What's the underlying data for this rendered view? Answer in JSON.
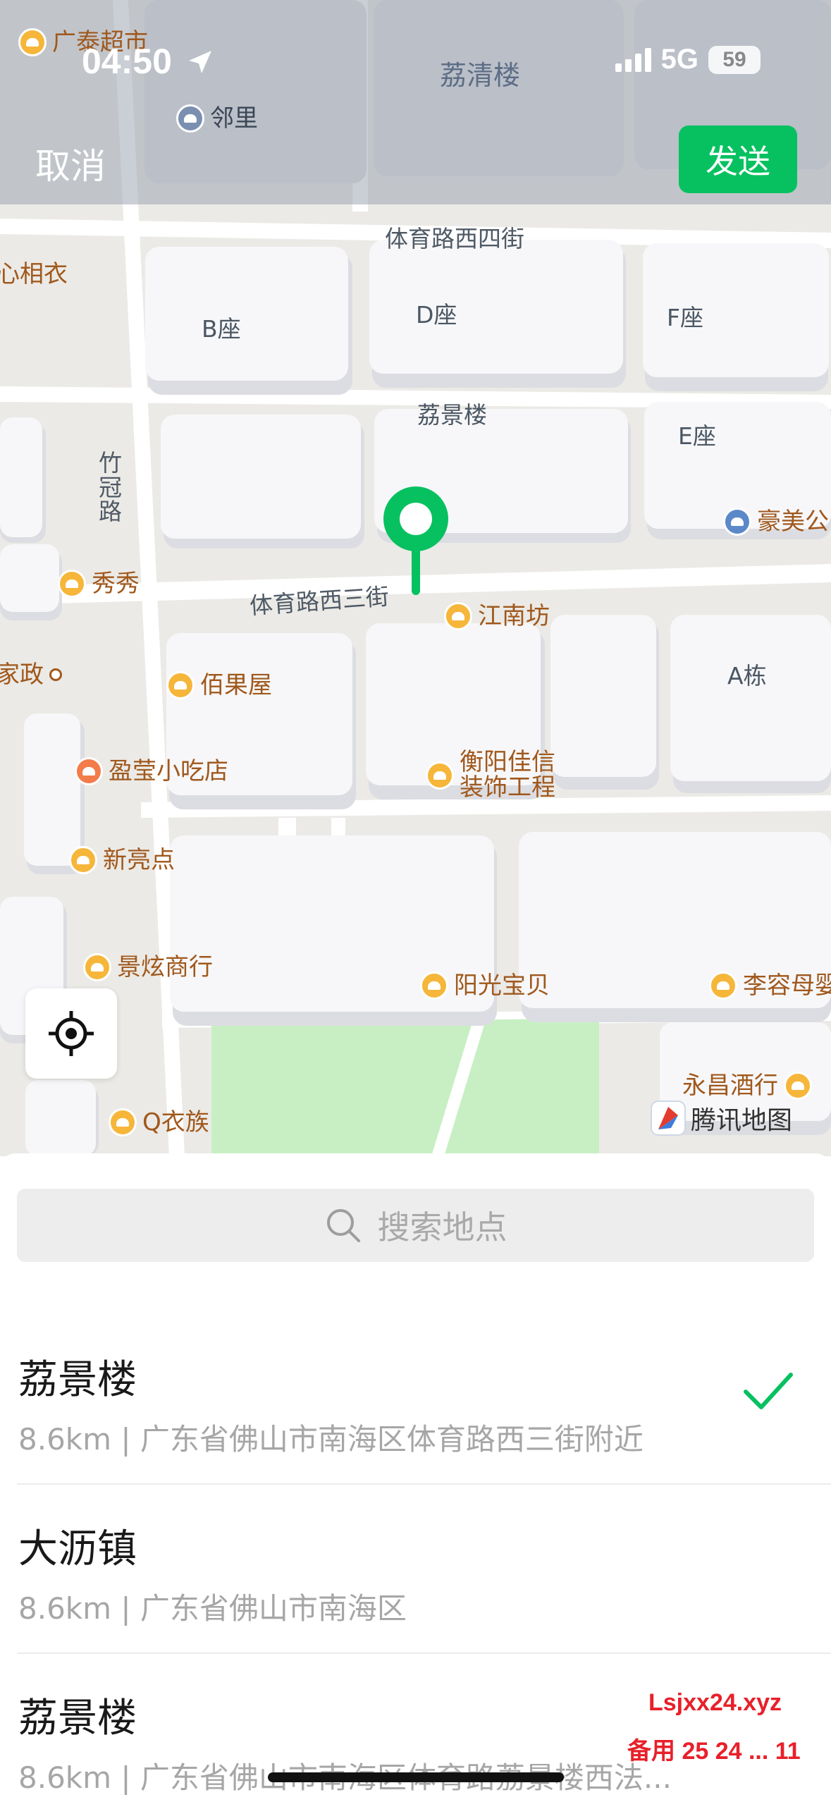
{
  "status_bar": {
    "time": "04:50",
    "network": "5G",
    "battery": "59"
  },
  "nav": {
    "cancel_label": "取消",
    "send_label": "发送"
  },
  "map": {
    "roads": [
      "体育路西四街",
      "体育路西三街",
      "竹冠路"
    ],
    "buildings": [
      "荔清楼",
      "B座",
      "D座",
      "F座",
      "荔景楼",
      "E座",
      "A栋"
    ],
    "pois": [
      "广泰超市",
      "邻里",
      "心相衣",
      "豪美公",
      "秀秀",
      "江南坊",
      "家政",
      "佰果屋",
      "盈莹小吃店",
      "衡阳佳信",
      "装饰工程",
      "新亮点",
      "景炫商行",
      "阳光宝贝",
      "李容母婴",
      "永昌酒行",
      "Q衣族"
    ],
    "logo_text": "腾讯地图",
    "icons": [
      "location-arrow-icon",
      "locate-me-icon",
      "map-pin-icon",
      "tencent-map-logo-icon"
    ]
  },
  "search": {
    "placeholder": "搜索地点"
  },
  "results": [
    {
      "title": "荔景楼",
      "subtitle": "8.6km | 广东省佛山市南海区体育路西三街附近",
      "selected": true
    },
    {
      "title": "大沥镇",
      "subtitle": "8.6km | 广东省佛山市南海区",
      "selected": false
    },
    {
      "title": "荔景楼",
      "subtitle": "8.6km | 广东省佛山市南海区体育路荔景楼西法...",
      "selected": false
    }
  ],
  "watermark": {
    "line1": "Lsjxx24.xyz",
    "line2": "备用 25 24 ... 11"
  },
  "colors": {
    "accent": "#07c160",
    "poi": "#f6b63a",
    "park": "#c8efc4"
  }
}
